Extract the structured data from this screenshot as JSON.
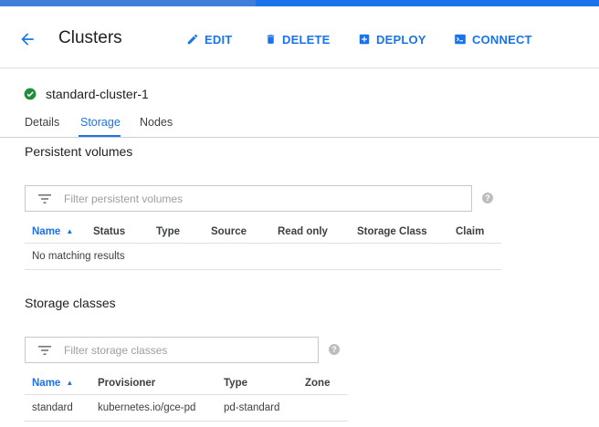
{
  "header": {
    "title": "Clusters",
    "actions": {
      "edit": "EDIT",
      "delete": "DELETE",
      "deploy": "DEPLOY",
      "connect": "CONNECT"
    }
  },
  "cluster": {
    "name": "standard-cluster-1",
    "status_icon": "check-circle-icon"
  },
  "tabs": [
    {
      "label": "Details",
      "active": false
    },
    {
      "label": "Storage",
      "active": true
    },
    {
      "label": "Nodes",
      "active": false
    }
  ],
  "persistent_volumes": {
    "title": "Persistent volumes",
    "filter_placeholder": "Filter persistent volumes",
    "columns": [
      "Name",
      "Status",
      "Type",
      "Source",
      "Read only",
      "Storage Class",
      "Claim"
    ],
    "sort_column": "Name",
    "empty_text": "No matching results"
  },
  "storage_classes": {
    "title": "Storage classes",
    "filter_placeholder": "Filter storage classes",
    "columns": [
      "Name",
      "Provisioner",
      "Type",
      "Zone"
    ],
    "sort_column": "Name",
    "rows": [
      {
        "name": "standard",
        "provisioner": "kubernetes.io/gce-pd",
        "type": "pd-standard",
        "zone": ""
      }
    ]
  },
  "colors": {
    "accent": "#1a73e8",
    "success": "#1e8e3e"
  }
}
